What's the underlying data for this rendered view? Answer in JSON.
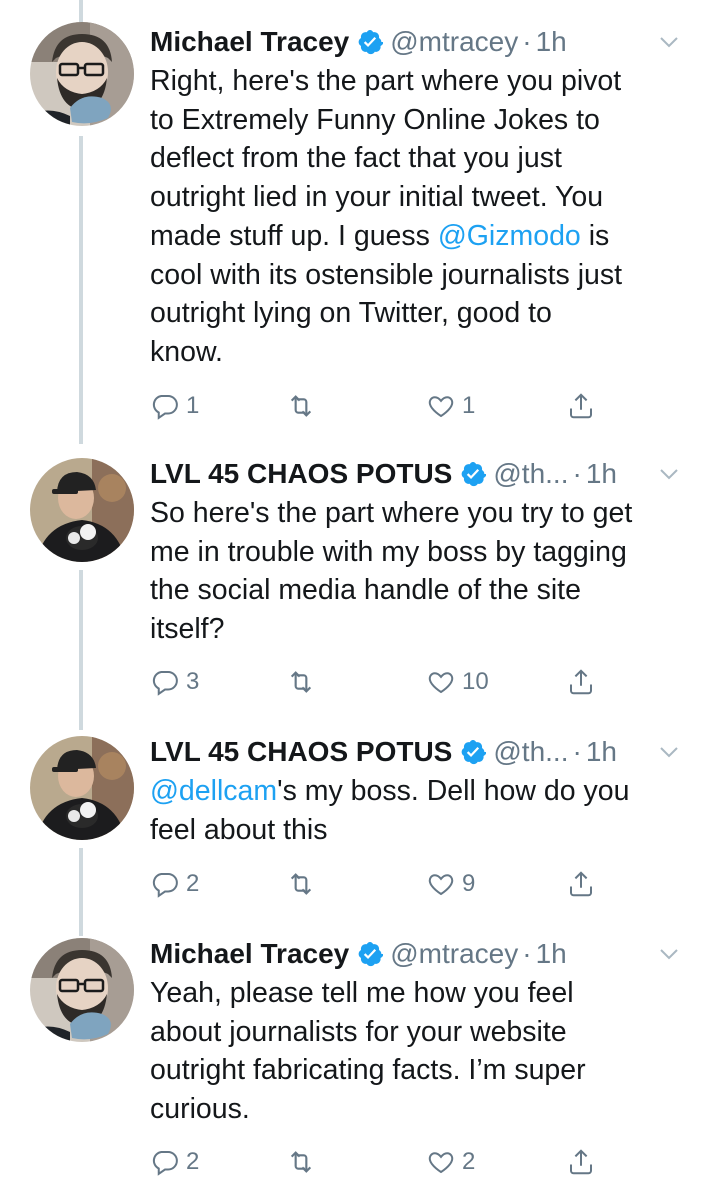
{
  "tweets": [
    {
      "name": "Michael Tracey",
      "handle": "@mtracey",
      "time": "1h",
      "avatar": "avatar-glasses-beard",
      "body_lines": [
        "Right, here's the part where you pivot",
        "to Extremely Funny Online Jokes to",
        "deflect from the fact that you just",
        "outright lied in your initial tweet. You"
      ],
      "body_mid_prefix": "made stuff up. I guess ",
      "body_mention": "@Gizmodo",
      "body_mid_suffix": " is",
      "body_lines_after": [
        "cool with its ostensible journalists just",
        "outright lying on Twitter, good to",
        "know."
      ],
      "replies": "1",
      "retweets": "",
      "likes": "1"
    },
    {
      "name": "LVL 45 CHAOS POTUS",
      "handle": "@th...",
      "time": "1h",
      "avatar": "avatar-cap-cat",
      "body_lines": [
        "So here's the part where you try to get",
        "me in trouble with my boss by tagging",
        "the social media handle of the site",
        "itself?"
      ],
      "replies": "3",
      "retweets": "",
      "likes": "10"
    },
    {
      "name": "LVL 45 CHAOS POTUS",
      "handle": "@th...",
      "time": "1h",
      "avatar": "avatar-cap-cat",
      "body_mention": "@dellcam",
      "body_first_suffix": "'s my boss. Dell how do you",
      "body_lines_after": [
        "feel about this"
      ],
      "replies": "2",
      "retweets": "",
      "likes": "9"
    },
    {
      "name": "Michael Tracey",
      "handle": "@mtracey",
      "time": "1h",
      "avatar": "avatar-glasses-beard",
      "body_lines": [
        "Yeah, please tell me how you feel",
        "about journalists for your website",
        "outright fabricating facts. I’m super",
        "curious."
      ],
      "replies": "2",
      "retweets": "",
      "likes": "2"
    }
  ],
  "icons": {
    "reply": "reply-icon",
    "retweet": "retweet-icon",
    "like": "heart-icon",
    "share": "share-icon",
    "verified": "verified-badge-icon",
    "caret": "chevron-down-icon"
  },
  "colors": {
    "link": "#1da1f2",
    "secondary": "#657786",
    "verified": "#1da1f2",
    "thread_line": "#cfd9de"
  }
}
